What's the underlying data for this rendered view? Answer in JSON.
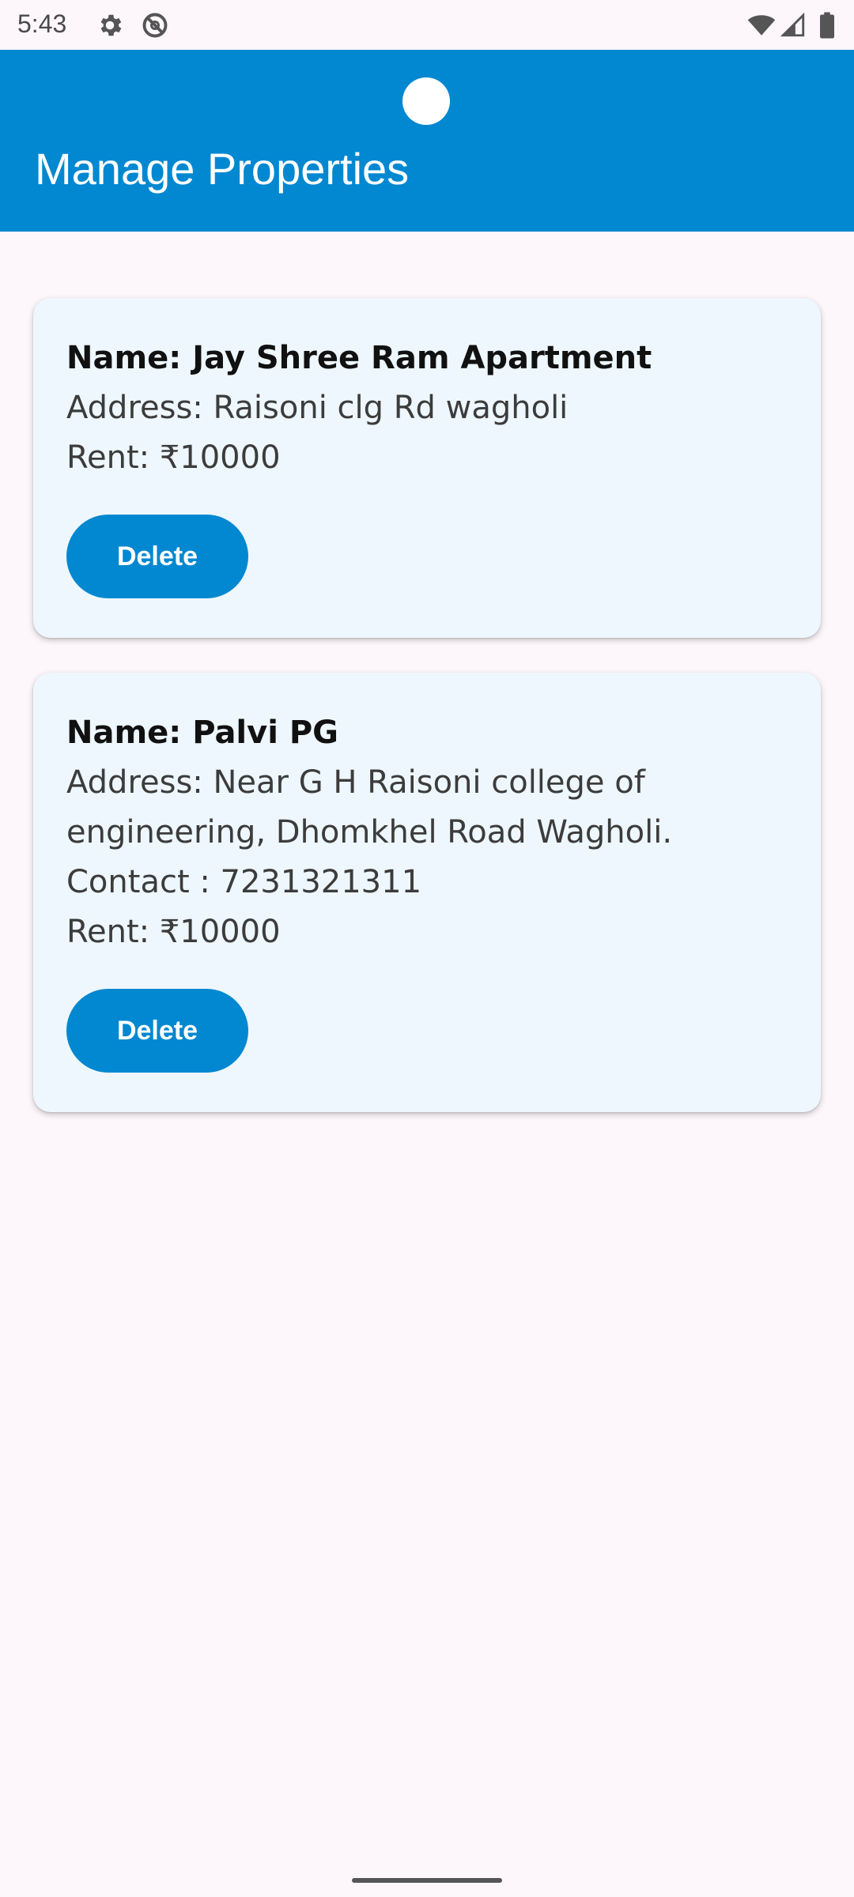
{
  "status_bar": {
    "time": "5:43",
    "icons": [
      "settings-icon",
      "do-not-disturb-icon",
      "wifi-icon",
      "signal-icon",
      "battery-icon"
    ]
  },
  "app_bar": {
    "title": "Manage Properties",
    "color": "#0288d1"
  },
  "properties": [
    {
      "name": "Name: Jay Shree Ram Apartment",
      "address": "Address: Raisoni clg Rd wagholi",
      "rent": "Rent: ₹10000",
      "delete_label": "Delete"
    },
    {
      "name": "Name: Palvi PG",
      "address_line1": "Address: Near G H Raisoni college of",
      "address_line2": "engineering, Dhomkhel Road Wagholi.",
      "contact": "Contact : 7231321311",
      "rent": "Rent: ₹10000",
      "delete_label": "Delete"
    }
  ],
  "colors": {
    "accent": "#0288d1",
    "card_background": "#eef7fd",
    "page_background": "#fdf7fb"
  }
}
